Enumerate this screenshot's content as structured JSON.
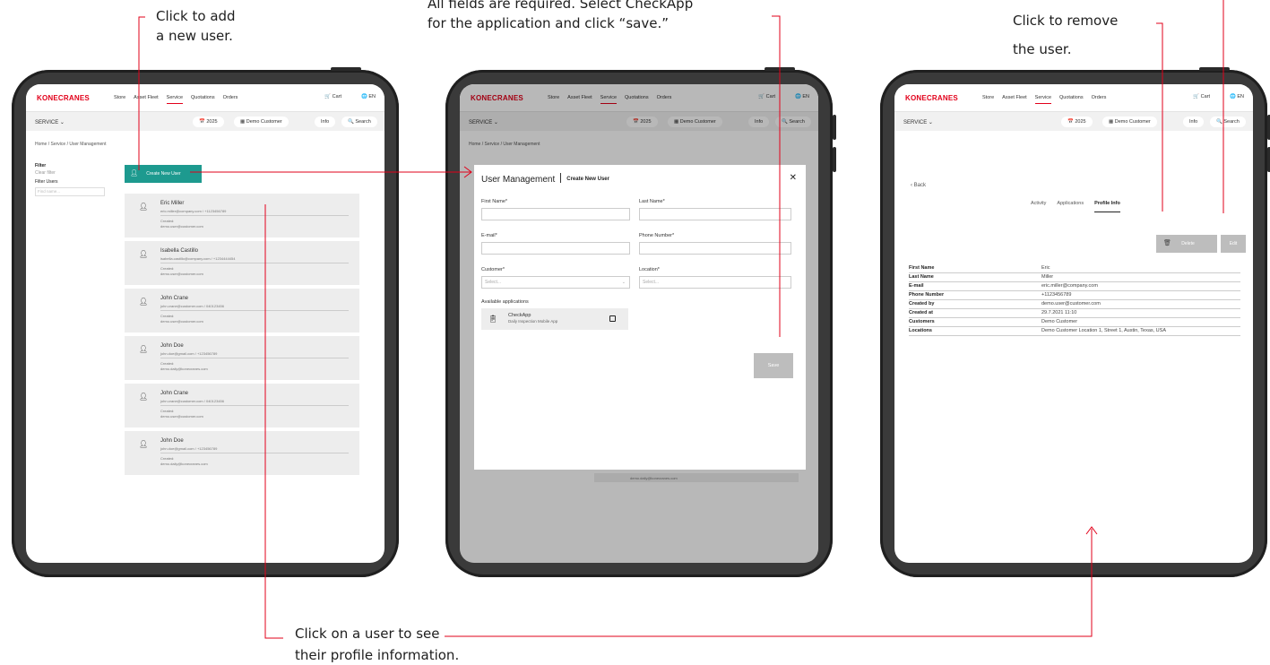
{
  "callouts": {
    "add_user_1": "Click to add",
    "add_user_2": "a new user.",
    "fields_1": "All fields are required. Select CheckApp",
    "fields_2": "for the application and click “save.”",
    "remove_1": "Click to remove",
    "remove_2": "the user.",
    "profile_1": "Click on a user to see",
    "profile_2": "their profile information."
  },
  "app": {
    "logo": "KONECRANES",
    "nav": [
      "Store",
      "Asset Fleet",
      "Service",
      "Quotations",
      "Orders"
    ],
    "cart": "🛒 Cart",
    "lang": "🌐 EN",
    "service_menu": "SERVICE ⌄",
    "year": "📅 2025",
    "customer": "▦ Demo Customer",
    "info": "Info",
    "search": "🔍 Search",
    "breadcrumb": "Home / Service / User Management"
  },
  "screen1": {
    "filter_title": "Filter",
    "clear_filter": "Clear filter",
    "filter_users": "Filter Users",
    "filter_placeholder": "Find name...",
    "create_label": "Create New User",
    "users": [
      {
        "name": "Eric Miller",
        "email": "eric.miller@company.com / +1123456789",
        "created": "Created:",
        "by": "demo.user@customer.com"
      },
      {
        "name": "Isabella Castillo",
        "email": "isabella.castillo@company.com / +1234444454",
        "created": "Created:",
        "by": "demo.user@customer.com"
      },
      {
        "name": "John Crane",
        "email": "john.crane@customer.com / 040123456",
        "created": "Created:",
        "by": "demo.user@customer.com"
      },
      {
        "name": "John Doe",
        "email": "john.doe@gmail.com / +123456789",
        "created": "Created:",
        "by": "demo.daily@konecranes.com"
      },
      {
        "name": "John Crane",
        "email": "john.crane@customer.com / 040123456",
        "created": "Created:",
        "by": "demo.user@customer.com"
      },
      {
        "name": "John Doe",
        "email": "john.doe@gmail.com / +123456789",
        "created": "Created:",
        "by": "demo.daily@konecranes.com"
      }
    ]
  },
  "screen2": {
    "title": "User Management",
    "subtitle": "Create New User",
    "close": "✕",
    "first_name": "First Name*",
    "last_name": "Last Name*",
    "email": "E-mail*",
    "phone": "Phone Number*",
    "customer": "Customer*",
    "location": "Location*",
    "select_placeholder": "Select...",
    "available_apps": "Available applications",
    "app_name": "CheckApp",
    "app_desc": "Daily Inspection Mobile App",
    "save": "Save",
    "bg_email": "demo.daily@konecranes.com"
  },
  "screen3": {
    "back": "‹ Back",
    "tabs": [
      "Activity",
      "Applications",
      "Profile Info"
    ],
    "delete": "Delete",
    "edit": "Edit",
    "profile": [
      {
        "k": "First Name",
        "v": "Eric"
      },
      {
        "k": "Last Name",
        "v": "Miller"
      },
      {
        "k": "E-mail",
        "v": "eric.miller@company.com"
      },
      {
        "k": "Phone Number",
        "v": "+1123456789"
      },
      {
        "k": "Created by",
        "v": "demo.user@customer.com"
      },
      {
        "k": "Created at",
        "v": "29.7.2021 11:10"
      },
      {
        "k": "Customers",
        "v": "Demo Customer"
      },
      {
        "k": "Locations",
        "v": "Demo Customer Location 1, Street 1, Austin, Texas, USA"
      }
    ]
  },
  "colors": {
    "accent": "#e2001a",
    "teal": "#1d9a8f",
    "frame": "#3a3a3a"
  }
}
